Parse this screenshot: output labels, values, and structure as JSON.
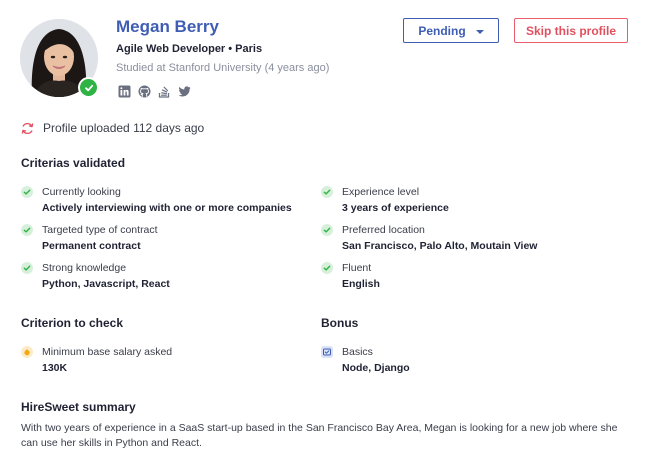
{
  "profile": {
    "name": "Megan Berry",
    "role": "Agile Web Developer • Paris",
    "studied": "Studied at Stanford University (4 years ago)",
    "socials": [
      "linkedin-icon",
      "github-icon",
      "stackoverflow-icon",
      "twitter-icon"
    ]
  },
  "actions": {
    "status_label": "Pending",
    "skip_label": "Skip this profile"
  },
  "upload": {
    "text": "Profile uploaded 112 days ago"
  },
  "colors": {
    "primary": "#3f5db3",
    "danger": "#e0505f",
    "success": "#2fb344",
    "warning": "#f3a712"
  },
  "criterias_validated": {
    "title": "Criterias validated",
    "items": [
      {
        "label": "Currently looking",
        "value": "Actively interviewing with one or more companies"
      },
      {
        "label": "Experience level",
        "value": "3 years of experience"
      },
      {
        "label": "Targeted type of contract",
        "value": "Permanent contract"
      },
      {
        "label": "Preferred location",
        "value": "San Francisco, Palo Alto, Moutain View"
      },
      {
        "label": "Strong knowledge",
        "value": "Python, Javascript, React"
      },
      {
        "label": "Fluent",
        "value": "English"
      }
    ]
  },
  "criterion_to_check": {
    "title": "Criterion to check",
    "items": [
      {
        "label": "Minimum base salary asked",
        "value": "130K"
      }
    ]
  },
  "bonus": {
    "title": "Bonus",
    "items": [
      {
        "label": "Basics",
        "value": "Node, Django"
      }
    ]
  },
  "summary": {
    "title": "HireSweet summary",
    "text": "With two years of experience in a SaaS start-up based in the San Francisco Bay Area, Megan is looking for a new job where she can use her skills in Python and React."
  }
}
